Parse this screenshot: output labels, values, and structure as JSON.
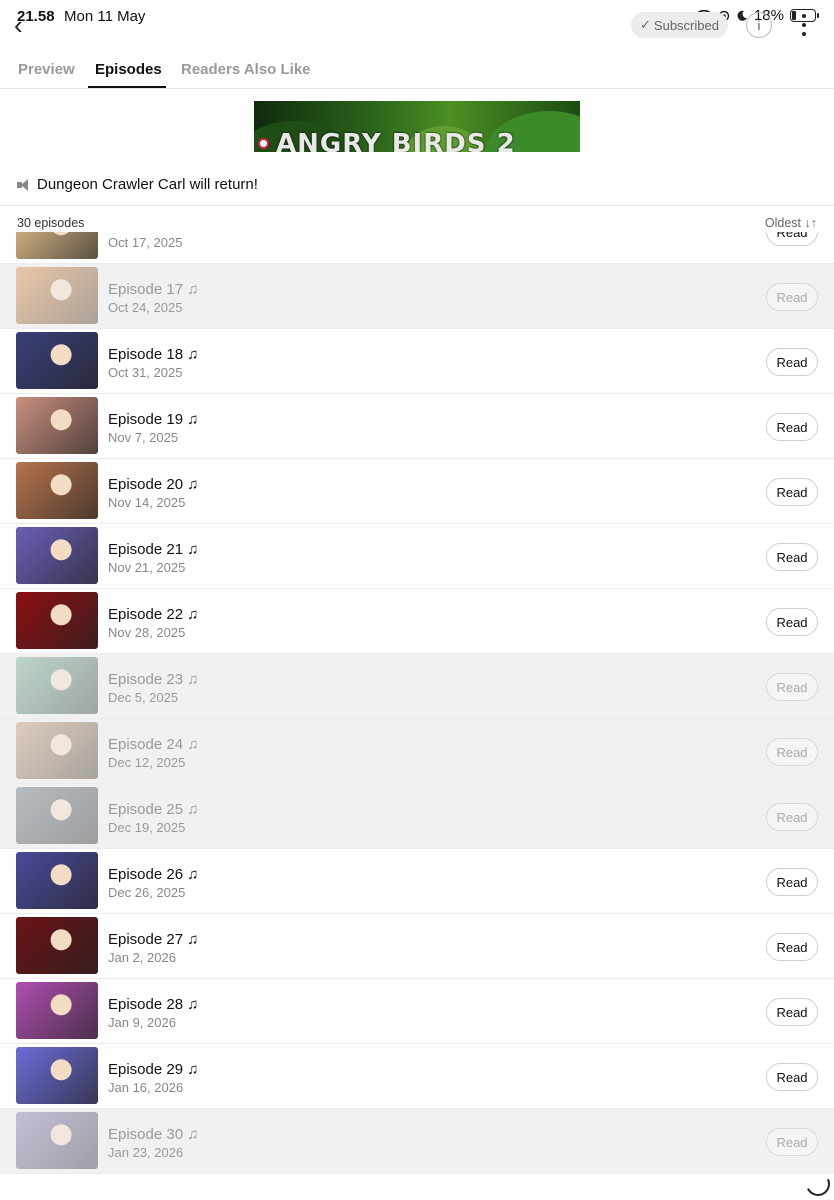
{
  "status": {
    "time": "21.58",
    "date": "Mon 11 May",
    "battery": "18%",
    "battery_level": 0.18
  },
  "header": {
    "subscribed_label": "Subscribed",
    "check_glyph": "✓",
    "info_glyph": "i",
    "back_glyph": "‹"
  },
  "tabs": [
    {
      "label": "Preview",
      "active": false
    },
    {
      "label": "Episodes",
      "active": true
    },
    {
      "label": "Readers Also Like",
      "active": false
    }
  ],
  "ad": {
    "text": "ANGRY BIRDS 2"
  },
  "announcement": "Dungeon Crawler Carl will return!",
  "list_header": {
    "count": "30 episodes",
    "sort": "Oldest ↓↑"
  },
  "episodes": [
    {
      "title": "",
      "date": "Oct 17, 2025",
      "read": false,
      "thumb": "#e9c58f"
    },
    {
      "title": "Episode 17 ♫",
      "date": "Oct 24, 2025",
      "read": true,
      "thumb": "#e2944f"
    },
    {
      "title": "Episode 18 ♫",
      "date": "Oct 31, 2025",
      "read": false,
      "thumb": "#3a3f7a"
    },
    {
      "title": "Episode 19 ♫",
      "date": "Nov 7, 2025",
      "read": false,
      "thumb": "#c98f7f"
    },
    {
      "title": "Episode 20 ♫",
      "date": "Nov 14, 2025",
      "read": false,
      "thumb": "#b7744c"
    },
    {
      "title": "Episode 21 ♫",
      "date": "Nov 21, 2025",
      "read": false,
      "thumb": "#6a5fb8"
    },
    {
      "title": "Episode 22 ♫",
      "date": "Nov 28, 2025",
      "read": false,
      "thumb": "#8a0f12"
    },
    {
      "title": "Episode 23 ♫",
      "date": "Dec 5, 2025",
      "read": true,
      "thumb": "#7fb49a"
    },
    {
      "title": "Episode 24 ♫",
      "date": "Dec 12, 2025",
      "read": true,
      "thumb": "#c7a27d"
    },
    {
      "title": "Episode 25 ♫",
      "date": "Dec 19, 2025",
      "read": true,
      "thumb": "#6f7c86"
    },
    {
      "title": "Episode 26 ♫",
      "date": "Dec 26, 2025",
      "read": false,
      "thumb": "#4b4a9c"
    },
    {
      "title": "Episode 27 ♫",
      "date": "Jan 2, 2026",
      "read": false,
      "thumb": "#6b1215"
    },
    {
      "title": "Episode 28 ♫",
      "date": "Jan 9, 2026",
      "read": false,
      "thumb": "#b04fb2"
    },
    {
      "title": "Episode 29 ♫",
      "date": "Jan 16, 2026",
      "read": false,
      "thumb": "#6c6cd9"
    },
    {
      "title": "Episode 30 ♫",
      "date": "Jan 23, 2026",
      "read": true,
      "thumb": "#8a83b8"
    }
  ],
  "read_label": "Read"
}
